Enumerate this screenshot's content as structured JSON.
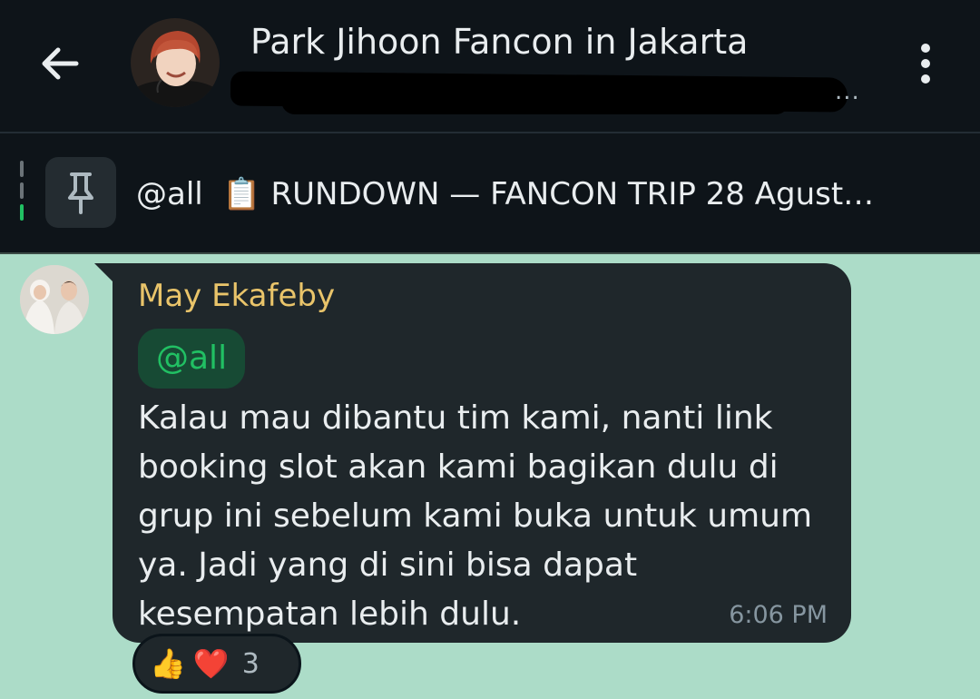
{
  "header": {
    "title": "Park Jihoon Fancon in Jakarta",
    "subtitle_ellipsis": "...",
    "icons": {
      "back": "arrow-left-icon",
      "menu": "more-vertical-icon",
      "avatar": "group-avatar"
    }
  },
  "pinned": {
    "mention": "@all",
    "clipboard_emoji": "📋",
    "text": "RUNDOWN — FANCON TRIP  28 Agust…",
    "icon": "pin-icon"
  },
  "message": {
    "sender": "May Ekafeby",
    "mention": "@all",
    "text": "Kalau mau dibantu tim kami, nanti link booking slot akan kami bagikan dulu di grup ini sebelum kami buka untuk umum ya. Jadi yang di sini bisa dapat kesempatan lebih dulu.",
    "time": "6:06 PM",
    "reactions": {
      "emojis": [
        "👍",
        "❤️"
      ],
      "count": "3"
    }
  },
  "colors": {
    "header_bg": "#0e1419",
    "chat_bg": "#acdcc8",
    "bubble_bg": "#1f272b",
    "sender_name": "#e9c46a",
    "mention_green": "#21c063"
  }
}
